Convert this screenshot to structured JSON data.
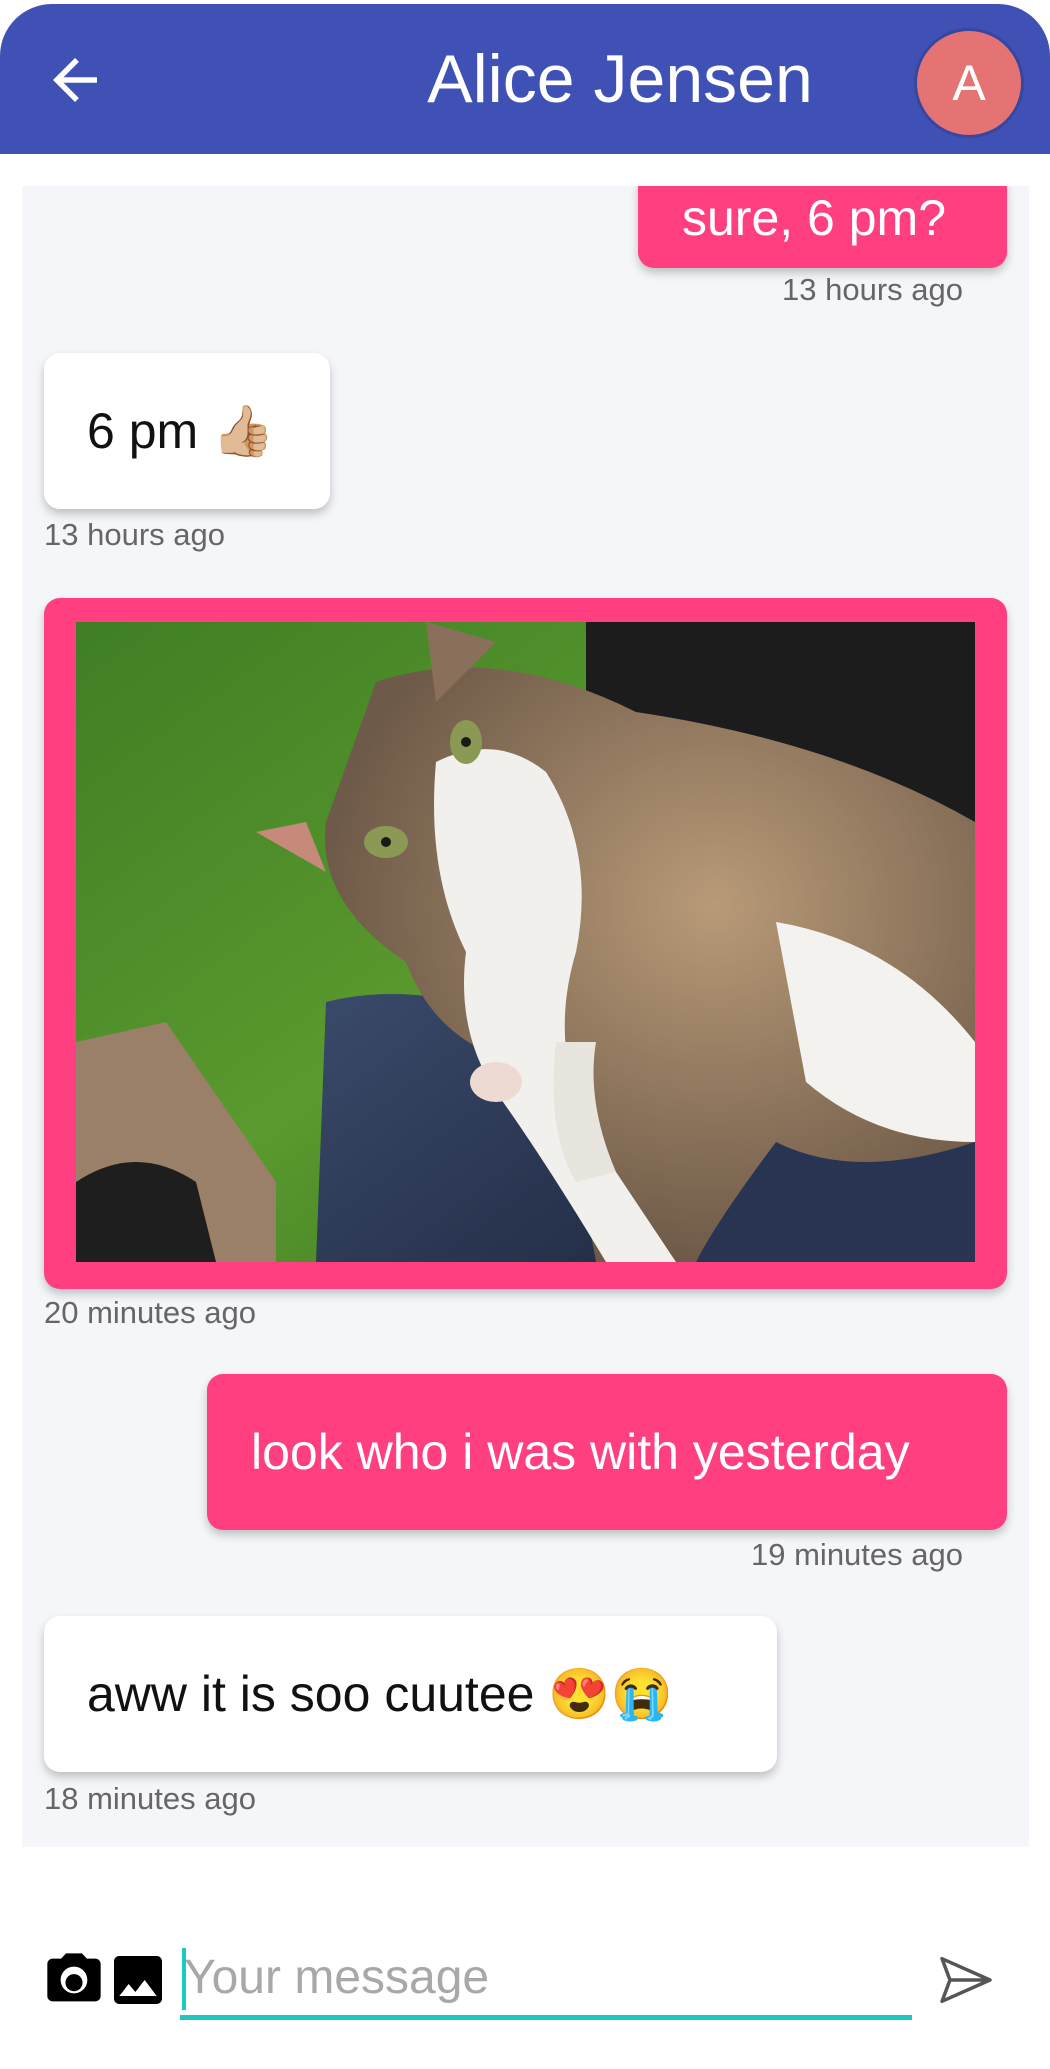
{
  "header": {
    "title": "Alice Jensen",
    "avatar_initial": "A",
    "back_icon": "arrow-left-icon"
  },
  "messages": [
    {
      "type": "text",
      "from": "me",
      "text": "sure, 6 pm?",
      "time": "13 hours ago"
    },
    {
      "type": "text",
      "from": "them",
      "text": "6 pm 👍🏼",
      "time": "13 hours ago"
    },
    {
      "type": "image",
      "from": "them",
      "description": "cat-photo",
      "time": "20 minutes ago"
    },
    {
      "type": "text",
      "from": "me",
      "text": "look who i was with yesterday",
      "time": "19 minutes ago"
    },
    {
      "type": "text",
      "from": "them",
      "text": "aww it is soo cuutee 😍😭",
      "time": "18 minutes ago"
    }
  ],
  "composer": {
    "placeholder": "Your message",
    "value": "",
    "camera_icon": "camera-icon",
    "gallery_icon": "image-icon",
    "send_icon": "send-icon"
  },
  "colors": {
    "appbar": "#3f51b5",
    "outgoing_bubble": "#ff3f80",
    "incoming_bubble": "#ffffff",
    "avatar": "#e57373",
    "input_underline": "#1ec7bf",
    "chat_background": "#f5f6fa"
  }
}
